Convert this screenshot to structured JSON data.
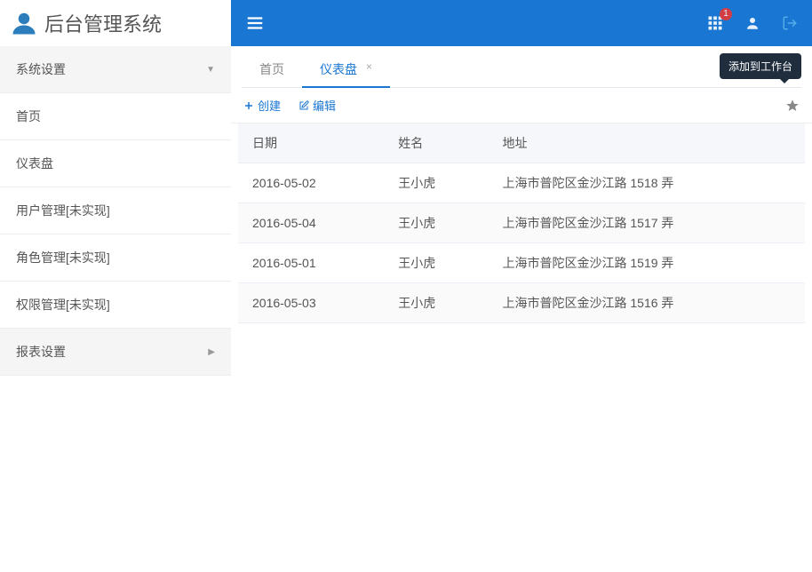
{
  "app": {
    "title": "后台管理系统"
  },
  "sidebar": {
    "groups": [
      {
        "label": "系统设置",
        "expanded": true
      },
      {
        "label": "报表设置",
        "expanded": false
      }
    ],
    "items": [
      {
        "label": "首页"
      },
      {
        "label": "仪表盘"
      },
      {
        "label": "用户管理[未实现]"
      },
      {
        "label": "角色管理[未实现]"
      },
      {
        "label": "权限管理[未实现]"
      }
    ]
  },
  "topbar": {
    "notification_count": "1"
  },
  "tabs": [
    {
      "label": "首页",
      "closable": false,
      "active": false
    },
    {
      "label": "仪表盘",
      "closable": true,
      "active": true
    }
  ],
  "tooltip": {
    "text": "添加到工作台"
  },
  "toolbar": {
    "create": "创建",
    "edit": "编辑"
  },
  "table": {
    "columns": [
      "日期",
      "姓名",
      "地址"
    ],
    "rows": [
      {
        "date": "2016-05-02",
        "name": "王小虎",
        "address": "上海市普陀区金沙江路 1518 弄"
      },
      {
        "date": "2016-05-04",
        "name": "王小虎",
        "address": "上海市普陀区金沙江路 1517 弄"
      },
      {
        "date": "2016-05-01",
        "name": "王小虎",
        "address": "上海市普陀区金沙江路 1519 弄"
      },
      {
        "date": "2016-05-03",
        "name": "王小虎",
        "address": "上海市普陀区金沙江路 1516 弄"
      }
    ]
  }
}
